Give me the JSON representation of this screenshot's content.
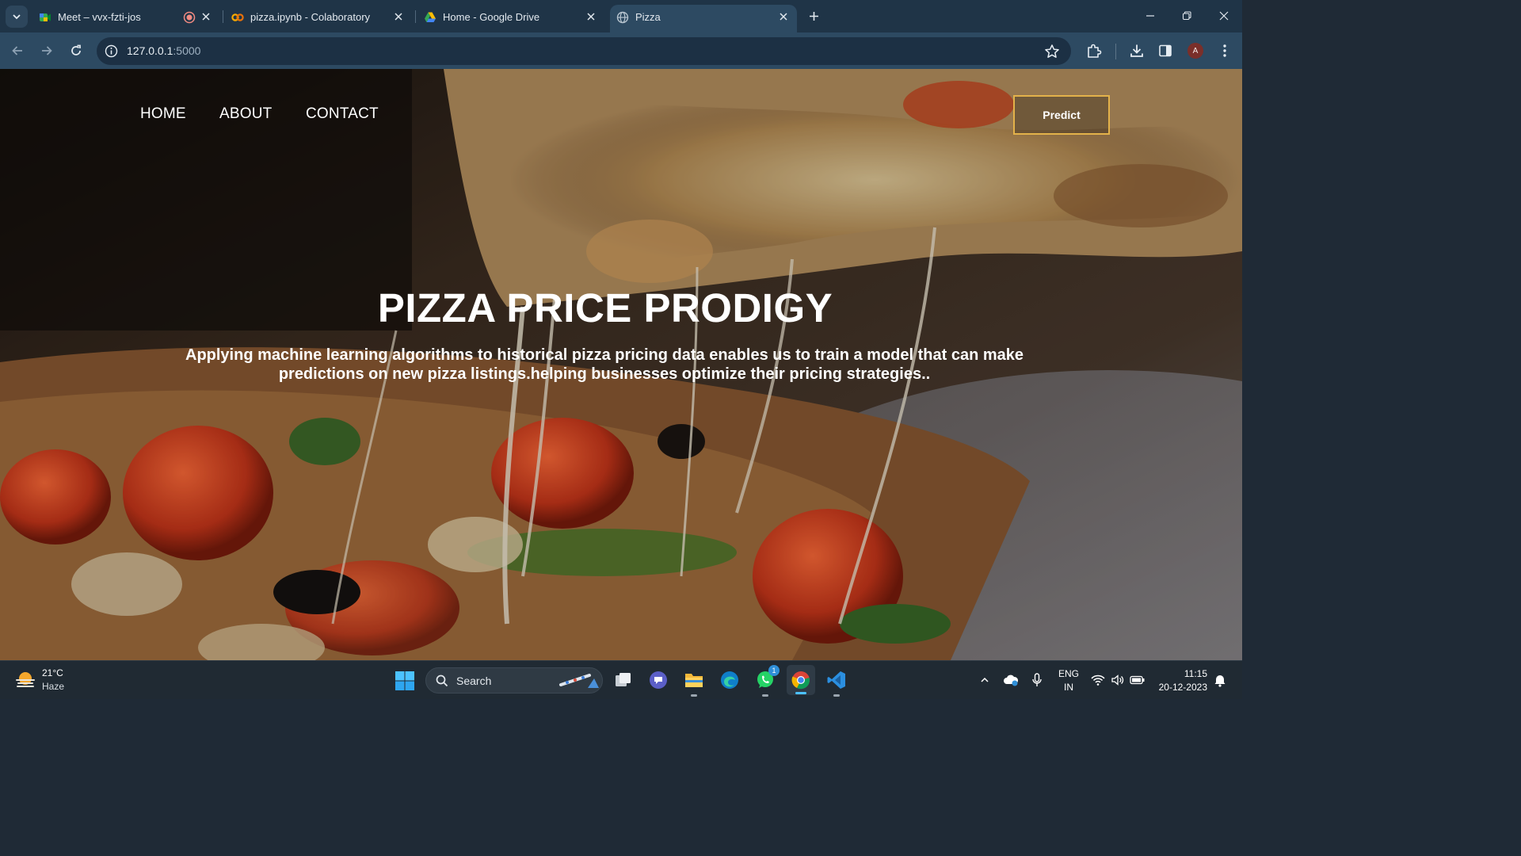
{
  "browser": {
    "tabs": [
      {
        "title": "Meet – vvx-fzti-jos",
        "icon": "google-meet-icon",
        "recording": true,
        "active": false
      },
      {
        "title": "pizza.ipynb - Colaboratory",
        "icon": "colab-icon",
        "active": false
      },
      {
        "title": "Home - Google Drive",
        "icon": "google-drive-icon",
        "active": false
      },
      {
        "title": "Pizza",
        "icon": "globe-icon",
        "active": true
      }
    ],
    "url_host": "127.0.0.1",
    "url_port": ":5000",
    "profile_initial": "A"
  },
  "page": {
    "nav": {
      "home": "HOME",
      "about": "ABOUT",
      "contact": "CONTACT"
    },
    "predict_label": "Predict",
    "title": "PIZZA PRICE PRODIGY",
    "subtitle_line1": "Applying machine learning algorithms to historical pizza pricing data enables us to train a model that can make",
    "subtitle_line2": "predictions on new pizza listings.helping businesses optimize their pricing strategies..",
    "accent_color": "#e3b24a"
  },
  "taskbar": {
    "weather_temp": "21°C",
    "weather_condition": "Haze",
    "search_label": "Search",
    "apps": [
      "file-explorer-icon",
      "teams-icon",
      "folder-icon",
      "edge-icon",
      "whatsapp-icon",
      "chrome-icon",
      "vscode-icon"
    ],
    "whatsapp_badge": "1",
    "language_line1": "ENG",
    "language_line2": "IN",
    "time": "11:15",
    "date": "20-12-2023"
  }
}
